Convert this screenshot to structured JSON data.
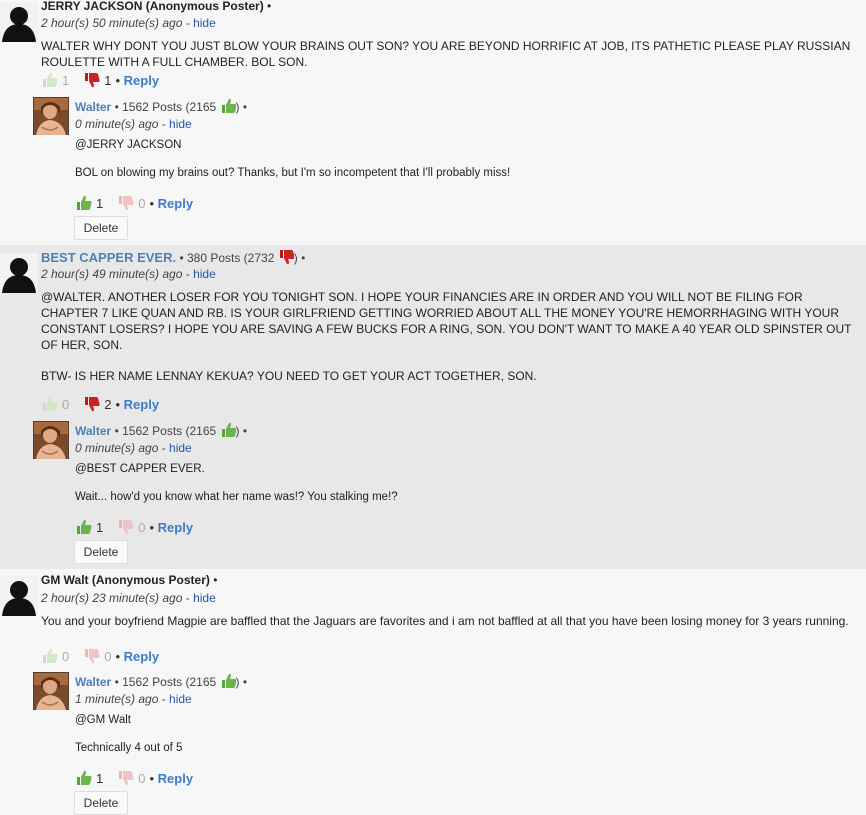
{
  "common": {
    "reply_label": "Reply",
    "hide_label": "hide",
    "delete_label": "Delete",
    "bullet": "•"
  },
  "comments": [
    {
      "author": "JERRY JACKSON (Anonymous Poster)",
      "time": "2 hour(s) 50 minute(s) ago",
      "text": "WALTER WHY DONT YOU JUST BLOW YOUR BRAINS OUT SON? YOU ARE BEYOND HORRIFIC AT JOB, ITS PATHETIC PLEASE PLAY RUSSIAN ROULETTE WITH A FULL CHAMBER. BOL SON.",
      "up_votes": "1",
      "down_votes": "1",
      "reply": {
        "author": "Walter",
        "posts": "1562 Posts (2165",
        "time": "0 minute(s) ago",
        "mention": "@JERRY JACKSON",
        "text": "BOL on blowing my brains out? Thanks, but I'm so incompetent that I'll probably miss!",
        "up_votes": "1",
        "down_votes": "0"
      }
    },
    {
      "author": "BEST CAPPER EVER.",
      "posts": "380 Posts (2732",
      "time": "2 hour(s) 49 minute(s) ago",
      "text": "@WALTER. ANOTHER LOSER FOR YOU TONIGHT SON. I HOPE YOUR FINANCIES ARE IN ORDER AND YOU WILL NOT BE FILING FOR CHAPTER 7 LIKE QUAN AND RB. IS YOUR GIRLFRIEND GETTING WORRIED ABOUT ALL THE MONEY YOU'RE HEMORRHAGING WITH YOUR CONSTANT LOSERS? I HOPE YOU ARE SAVING A FEW BUCKS FOR A RING, SON. YOU DON'T WANT TO MAKE A 40 YEAR OLD SPINSTER OUT OF HER, SON.",
      "text2": "BTW- IS HER NAME LENNAY KEKUA? YOU NEED TO GET YOUR ACT TOGETHER, SON.",
      "up_votes": "0",
      "down_votes": "2",
      "reply": {
        "author": "Walter",
        "posts": "1562 Posts (2165",
        "time": "0 minute(s) ago",
        "mention": "@BEST CAPPER EVER.",
        "text": "Wait... how'd you know what her name was!? You stalking me!?",
        "up_votes": "1",
        "down_votes": "0"
      }
    },
    {
      "author": "GM Walt (Anonymous Poster)",
      "time": "2 hour(s) 23 minute(s) ago",
      "text": "You and your boyfriend Magpie are baffled that the Jaguars are favorites and i am not baffled at all that you have been losing money for 3 years running.",
      "up_votes": "0",
      "down_votes": "0",
      "reply": {
        "author": "Walter",
        "posts": "1562 Posts (2165",
        "time": "1 minute(s) ago",
        "mention": "@GM Walt",
        "text": "Technically 4 out of 5",
        "up_votes": "1",
        "down_votes": "0"
      }
    }
  ],
  "colors": {
    "link_blue": "#3d7cc9",
    "author_blue": "#4f7fb8",
    "thumb_up_green": "#6bb64a",
    "thumb_down_red": "#cc2222",
    "highlight_bg": "#e8e8e8"
  }
}
